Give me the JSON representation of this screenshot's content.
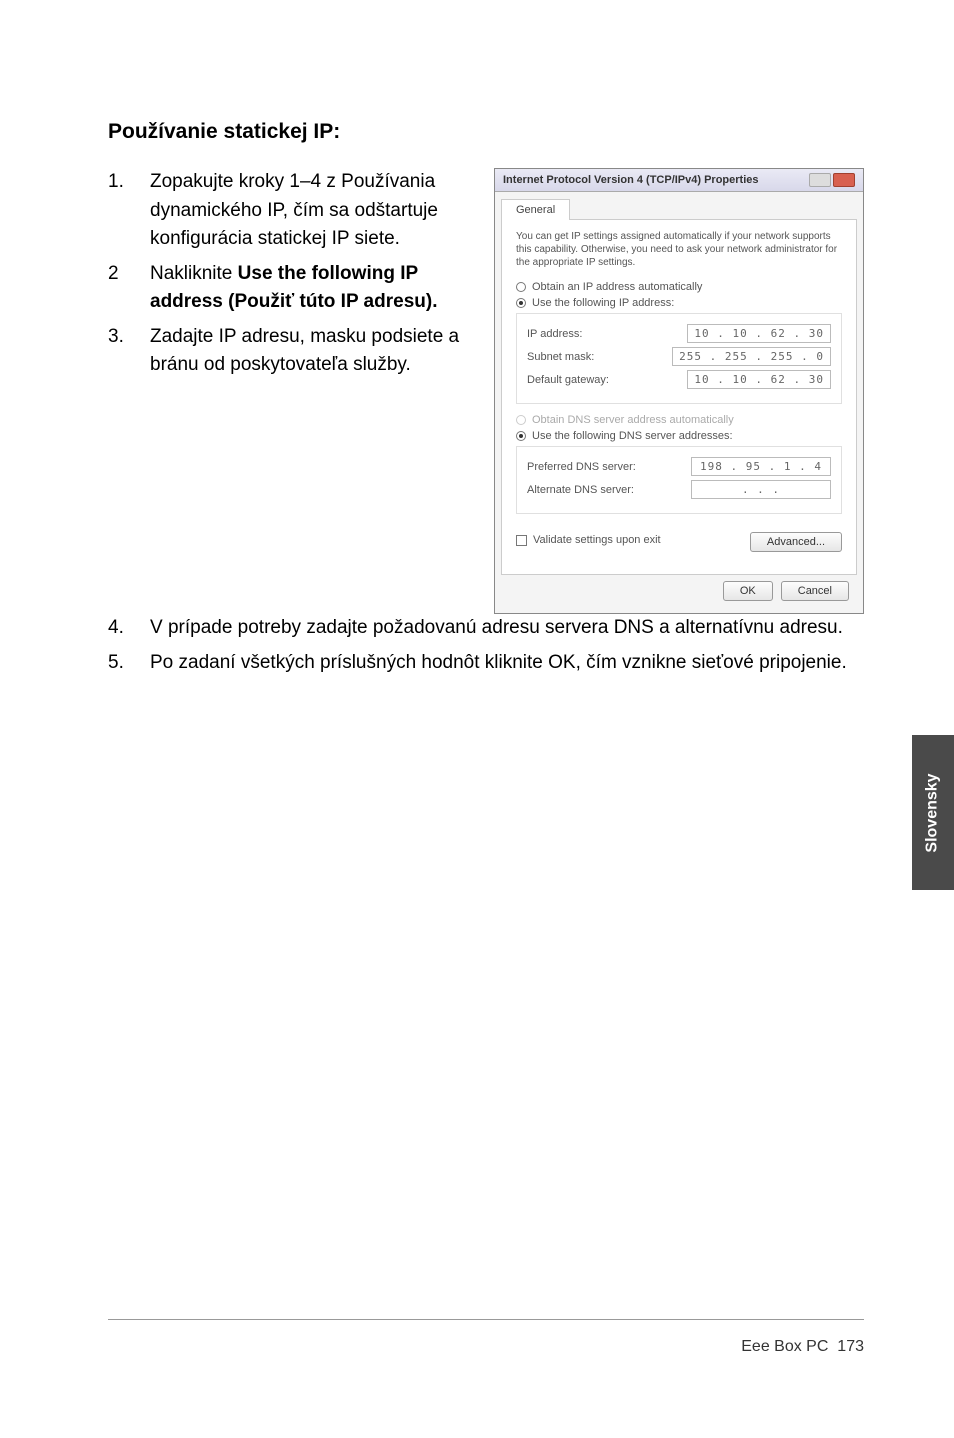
{
  "heading": "Používanie statickej IP:",
  "items": [
    {
      "num": "1.",
      "text": "Zopakujte kroky 1–4 z Používania dynamického IP, čím sa odštartuje konfigurácia statickej IP siete."
    },
    {
      "num": "2",
      "pre": "Nakliknite ",
      "bold": "Use the following IP address (Použiť túto IP adresu)."
    },
    {
      "num": "3.",
      "text": "Zadajte IP adresu, masku podsiete a bránu od poskytovateľa služby."
    }
  ],
  "full_items": [
    {
      "num": "4.",
      "text": "V prípade potreby zadajte požadovanú adresu servera DNS a alternatívnu adresu."
    },
    {
      "num": "5.",
      "text": "Po zadaní všetkých príslušných hodnôt kliknite OK, čím vznikne sieťové pripojenie."
    }
  ],
  "dialog": {
    "title": "Internet Protocol Version 4 (TCP/IPv4) Properties",
    "tab": "General",
    "desc": "You can get IP settings assigned automatically if your network supports this capability. Otherwise, you need to ask your network administrator for the appropriate IP settings.",
    "opt_auto_ip": "Obtain an IP address automatically",
    "opt_use_ip": "Use the following IP address:",
    "fld_ip": "IP address:",
    "val_ip": "10 . 10 . 62 . 30",
    "fld_mask": "Subnet mask:",
    "val_mask": "255 . 255 . 255 . 0",
    "fld_gw": "Default gateway:",
    "val_gw": "10 . 10 . 62 . 30",
    "opt_auto_dns": "Obtain DNS server address automatically",
    "opt_use_dns": "Use the following DNS server addresses:",
    "fld_pref": "Preferred DNS server:",
    "val_pref": "198 . 95 . 1 . 4",
    "fld_alt": "Alternate DNS server:",
    "val_alt": ".   .   .",
    "chk": "Validate settings upon exit",
    "btn_adv": "Advanced...",
    "btn_ok": "OK",
    "btn_cancel": "Cancel"
  },
  "side_tab": "Slovensky",
  "footer_model": "Eee Box PC",
  "footer_page": "173"
}
